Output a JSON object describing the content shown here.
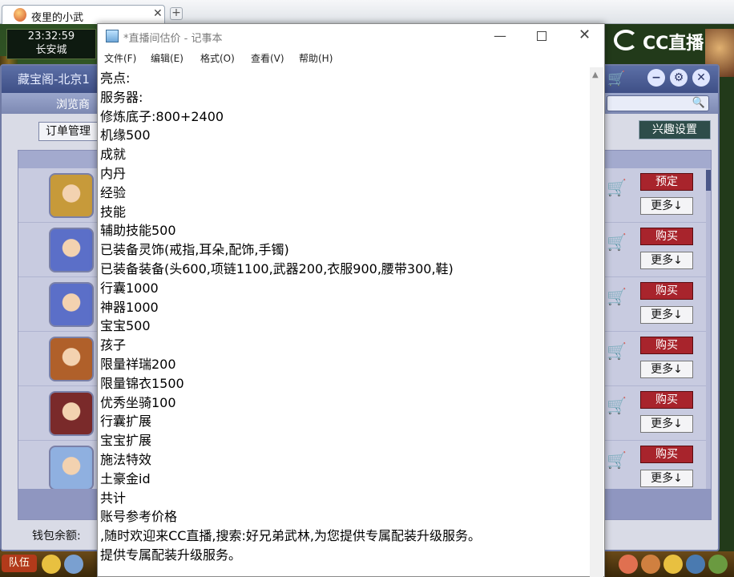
{
  "browser": {
    "tab_title": "夜里的小武",
    "tab_close": "✕",
    "new_tab": "+"
  },
  "game": {
    "clock_time": "23:32:59",
    "city": "长安城",
    "cc_logo": "CC直播",
    "trade": {
      "title": "藏宝阁-北京1",
      "browse_label": "浏览商",
      "order_button": "订单管理",
      "interest_button": "兴趣设置",
      "wallet_label": "钱包余额:",
      "rows": [
        {
          "action": "预定",
          "more": "更多↓",
          "avatar_color": "#c79a3a"
        },
        {
          "action": "购买",
          "more": "更多↓",
          "avatar_color": "#5b6fc8"
        },
        {
          "action": "购买",
          "more": "更多↓",
          "avatar_color": "#5b6fc8"
        },
        {
          "action": "购买",
          "more": "更多↓",
          "avatar_color": "#b0602a"
        },
        {
          "action": "购买",
          "more": "更多↓",
          "avatar_color": "#7a2a2a"
        },
        {
          "action": "购买",
          "more": "更多↓",
          "avatar_color": "#8fb0e0"
        }
      ]
    },
    "bottom_team": "队伍"
  },
  "notepad": {
    "title": "*直播间估价 - 记事本",
    "menu": [
      "文件(F)",
      "编辑(E)",
      "格式(O)",
      "查看(V)",
      "帮助(H)"
    ],
    "lines": [
      "亮点:",
      "服务器:",
      "修炼底子:800+2400",
      "机缘500",
      "成就",
      "内丹",
      "经验",
      "技能",
      "辅助技能500",
      "已装备灵饰(戒指,耳朵,配饰,手镯)",
      "已装备装备(头600,项链1100,武器200,衣服900,腰带300,鞋)",
      "行囊1000",
      "神器1000",
      "宝宝500",
      "孩子",
      "限量祥瑞200",
      "限量锦衣1500",
      "优秀坐骑100",
      "行囊扩展",
      "宝宝扩展",
      "施法特效",
      "土豪金id",
      "共计",
      "账号参考价格",
      ",随时欢迎来CC直播,搜索:好兄弟武林,为您提供专属配装升级服务。",
      "提供专属配装升级服务。"
    ]
  }
}
